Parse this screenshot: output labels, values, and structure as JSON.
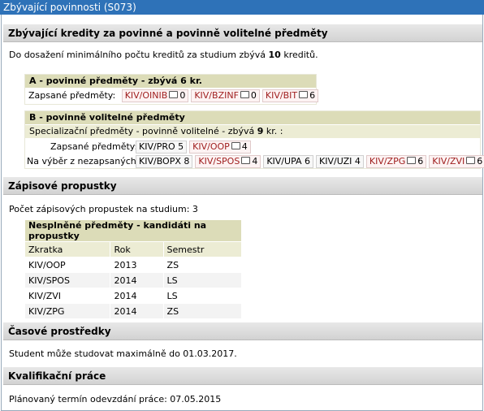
{
  "window": {
    "title": "Zbývající povinnosti (S073)"
  },
  "credits": {
    "heading": "Zbývající kredity za povinné a povinně volitelné předměty",
    "summary_prefix": "Do dosažení minimálního počtu kreditů za studium zbývá ",
    "summary_value": "10",
    "summary_suffix": " kreditů.",
    "group_a": {
      "title": "A - povinné předměty - zbývá 6 kr.",
      "enrolled_label": "Zapsané předměty:",
      "courses": [
        {
          "code": "KIV/OINIB",
          "count": "0",
          "comment_icon": "comment-icon"
        },
        {
          "code": "KIV/BZINF",
          "count": "0",
          "comment_icon": "comment-icon"
        },
        {
          "code": "KIV/BIT",
          "count": "6",
          "comment_icon": "comment-icon"
        }
      ]
    },
    "group_b": {
      "title": "B - povinně volitelné předměty",
      "subtitle_prefix": "Specializační předměty - povinně volitelné - zbývá ",
      "subtitle_value": "9",
      "subtitle_suffix": " kr. :",
      "enrolled_label": "Zapsané předměty:",
      "enrolled": [
        {
          "code": "KIV/PRO",
          "count": "5",
          "red": false
        },
        {
          "code": "KIV/OOP",
          "count": "4",
          "red": true
        }
      ],
      "choice_label": "Na výběr z nezapsaných:",
      "choices": [
        {
          "code": "KIV/BOPX",
          "count": "8",
          "red": false
        },
        {
          "code": "KIV/SPOS",
          "count": "4",
          "red": true
        },
        {
          "code": "KIV/UPA",
          "count": "6",
          "red": false
        },
        {
          "code": "KIV/UZI",
          "count": "4",
          "red": false
        },
        {
          "code": "KIV/ZPG",
          "count": "6",
          "red": true
        },
        {
          "code": "KIV/ZVI",
          "count": "6",
          "red": true
        }
      ]
    }
  },
  "passes": {
    "heading": "Zápisové propustky",
    "count_text": "Počet zápisových propustek na studium: 3",
    "table_title": "Nesplněné předměty - kandidáti na propustky",
    "columns": [
      "Zkratka",
      "Rok",
      "Semestr"
    ],
    "rows": [
      [
        "KIV/OOP",
        "2013",
        "ZS"
      ],
      [
        "KIV/SPOS",
        "2014",
        "LS"
      ],
      [
        "KIV/ZVI",
        "2014",
        "LS"
      ],
      [
        "KIV/ZPG",
        "2014",
        "ZS"
      ]
    ]
  },
  "time": {
    "heading": "Časové prostředky",
    "text": "Student může studovat maximálně do 01.03.2017."
  },
  "thesis": {
    "heading": "Kvalifikační práce",
    "text": "Plánovaný termín odevzdání práce: 07.05.2015"
  },
  "colors": {
    "titlebar": "#2e72b8",
    "red_course": "#a02020",
    "box_header": "#dcdcb8"
  }
}
